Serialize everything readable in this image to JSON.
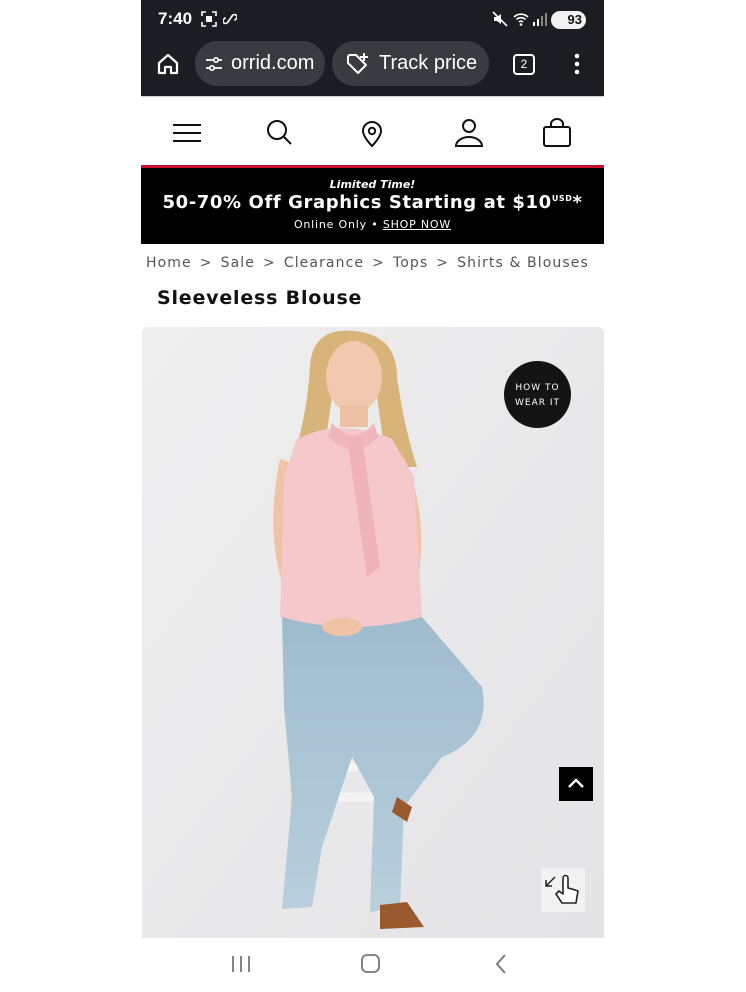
{
  "status_bar": {
    "time": "7:40",
    "battery": "93",
    "icons": [
      "screenshot-icon",
      "link-icon",
      "mute-icon",
      "wifi-icon",
      "signal-icon",
      "battery-icon"
    ]
  },
  "browser": {
    "url": "orrid.com",
    "track_price_label": "Track price",
    "tab_count": "2"
  },
  "site_nav": {
    "icons": [
      "menu-icon",
      "search-icon",
      "location-icon",
      "account-icon",
      "bag-icon"
    ]
  },
  "promo": {
    "eyebrow": "Limited Time!",
    "headline": "50-70% Off Graphics Starting at $10",
    "currency": "USD",
    "asterisk": "*",
    "subtext": "Online Only •",
    "link": "SHOP NOW",
    "accent_color": "#c8102e"
  },
  "breadcrumb": {
    "items": [
      "Home",
      "Sale",
      "Clearance",
      "Tops",
      "Shirts & Blouses"
    ],
    "separator": ">"
  },
  "product": {
    "title": "Sleeveless Blouse",
    "badge_line1": "HOW TO",
    "badge_line2": "WEAR IT"
  },
  "system_nav": {
    "icons": [
      "recent-apps-icon",
      "home-icon",
      "back-icon"
    ]
  }
}
